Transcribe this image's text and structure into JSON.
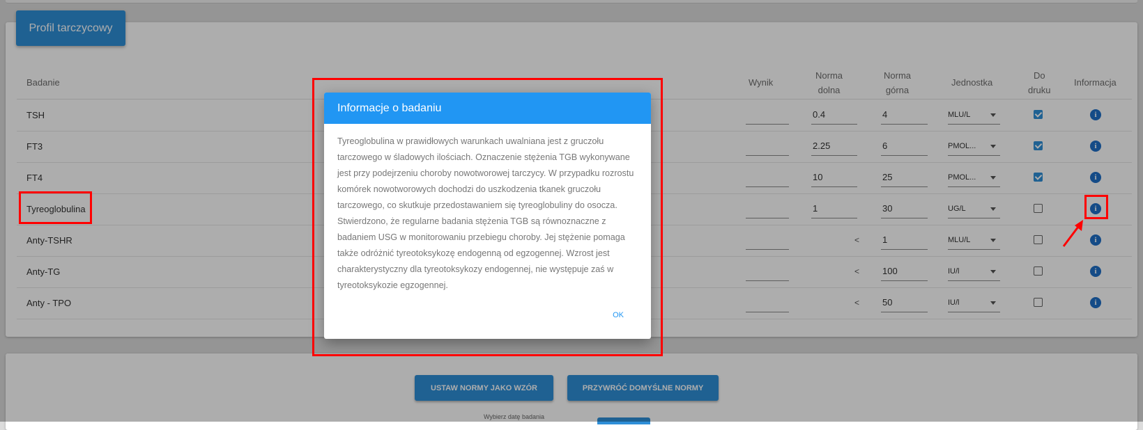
{
  "profile_button": "Profil tarczycowy",
  "table": {
    "headers": {
      "test": "Badanie",
      "result": "Wynik",
      "norm_low": [
        "Norma",
        "dolna"
      ],
      "norm_high": [
        "Norma",
        "górna"
      ],
      "unit": "Jednostka",
      "print": [
        "Do",
        "druku"
      ],
      "info": "Informacja"
    },
    "rows": [
      {
        "name": "TSH",
        "result": "",
        "low": "0.4",
        "high": "4",
        "unit": "MLU/L",
        "print": true
      },
      {
        "name": "FT3",
        "result": "",
        "low": "2.25",
        "high": "6",
        "unit": "PMOL...",
        "print": true
      },
      {
        "name": "FT4",
        "result": "",
        "low": "10",
        "high": "25",
        "unit": "PMOL...",
        "print": true
      },
      {
        "name": "Tyreoglobulina",
        "result": "",
        "low": "1",
        "high": "30",
        "unit": "UG/L",
        "print": false
      },
      {
        "name": "Anty-TSHR",
        "result": "",
        "low": "<",
        "high": "1",
        "unit": "MLU/L",
        "print": false
      },
      {
        "name": "Anty-TG",
        "result": "",
        "low": "<",
        "high": "100",
        "unit": "IU/l",
        "print": false
      },
      {
        "name": "Anty - TPO",
        "result": "",
        "low": "<",
        "high": "50",
        "unit": "IU/l",
        "print": false
      }
    ]
  },
  "modal": {
    "title": "Informacje o badaniu",
    "body": "Tyreoglobulina w prawidłowych warunkach uwalniana jest z gruczołu tarczowego w śladowych ilościach. Oznaczenie stężenia TGB wykonywane jest przy podejrzeniu choroby nowotworowej tarczycy. W przypadku rozrostu komórek nowotworowych dochodzi do uszkodzenia tkanek gruczołu tarczowego, co skutkuje przedostawaniem się tyreoglobuliny do osocza. Stwierdzono, że regularne badania stężenia TGB są równoznaczne z badaniem USG w monitorowaniu przebiegu choroby. Jej stężenie pomaga także odróżnić tyreotoksykozę endogenną od egzogennej. Wzrost jest charakterystyczny dla tyreotoksykozy endogennej, nie występuje zaś w tyreotoksykozie egzogennej.",
    "ok": "OK"
  },
  "actions": {
    "set_norms": "USTAW NORMY JAKO WZÓR",
    "restore_norms": "PRZYWRÓĆ DOMYŚLNE NORMY",
    "date_label": "Wybierz datę badania"
  },
  "colors": {
    "primary": "#2f8fd8",
    "modal_header": "#2196f3",
    "highlight": "#ff0000"
  }
}
